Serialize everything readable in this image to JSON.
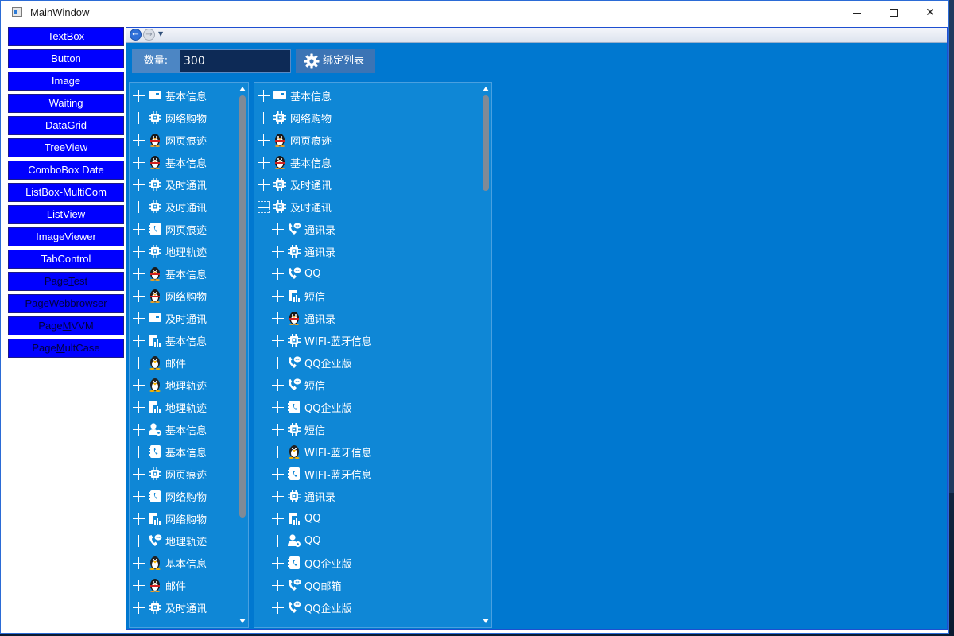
{
  "window": {
    "title": "MainWindow",
    "minimize_glyph": "",
    "close_glyph": "✕"
  },
  "sidebar": {
    "items": [
      {
        "label": "TextBox"
      },
      {
        "label": "Button"
      },
      {
        "label": "Image"
      },
      {
        "label": "Waiting"
      },
      {
        "label": "DataGrid"
      },
      {
        "label": "TreeView"
      },
      {
        "label": "ComboBox Date"
      },
      {
        "label": "ListBox-MultiCom"
      },
      {
        "label": "ListView"
      },
      {
        "label": "ImageViewer"
      },
      {
        "label": "TabControl"
      },
      {
        "label": "PageTest",
        "pre": "Page",
        "ul": "T",
        "post": "est"
      },
      {
        "label": "PageWebbrowser",
        "pre": "Page",
        "ul": "W",
        "post": "ebbrowser"
      },
      {
        "label": "PageMVVM",
        "pre": "Page",
        "ul": "M",
        "post": "VVM"
      },
      {
        "label": "PageMultCase",
        "pre": "Page",
        "ul": "M",
        "post": "ultCase"
      }
    ]
  },
  "browser_nav": {
    "back_glyph": "←",
    "forward_glyph": "→",
    "dropdown_glyph": "▼"
  },
  "toolbar": {
    "quantity_label": "数量:",
    "quantity_value": "300",
    "bind_button_label": "绑定列表"
  },
  "tree_left": {
    "rows": [
      {
        "icon": "id-card-icon",
        "label": "基本信息"
      },
      {
        "icon": "chip-icon",
        "label": "网络购物"
      },
      {
        "icon": "penguin-icon",
        "label": "网页痕迹"
      },
      {
        "icon": "penguin-icon",
        "label": "基本信息"
      },
      {
        "icon": "chip-icon",
        "label": "及时通讯"
      },
      {
        "icon": "chip-icon",
        "label": "及时通讯"
      },
      {
        "icon": "phone-book-icon",
        "label": "网页痕迹"
      },
      {
        "icon": "chip-icon",
        "label": "地理轨迹"
      },
      {
        "icon": "penguin-icon",
        "label": "基本信息"
      },
      {
        "icon": "penguin-icon",
        "label": "网络购物"
      },
      {
        "icon": "id-card-icon",
        "label": "及时通讯"
      },
      {
        "icon": "chart-doc-icon",
        "label": "基本信息"
      },
      {
        "icon": "penguin-color-icon",
        "label": "邮件"
      },
      {
        "icon": "penguin-color-icon",
        "label": "地理轨迹"
      },
      {
        "icon": "chart-doc-icon",
        "label": "地理轨迹"
      },
      {
        "icon": "user-gear-icon",
        "label": "基本信息"
      },
      {
        "icon": "phone-book-icon",
        "label": "基本信息"
      },
      {
        "icon": "chip-icon",
        "label": "网页痕迹"
      },
      {
        "icon": "phone-book-icon",
        "label": "网络购物"
      },
      {
        "icon": "chart-doc-icon",
        "label": "网络购物"
      },
      {
        "icon": "phone-chat-icon",
        "label": "地理轨迹"
      },
      {
        "icon": "penguin-color-icon",
        "label": "基本信息"
      },
      {
        "icon": "penguin-icon",
        "label": "邮件"
      },
      {
        "icon": "chip-icon",
        "label": "及时通讯"
      }
    ]
  },
  "tree_right": {
    "rows": [
      {
        "indent": 0,
        "icon": "id-card-icon",
        "label": "基本信息",
        "open": false
      },
      {
        "indent": 0,
        "icon": "chip-icon",
        "label": "网络购物",
        "open": false
      },
      {
        "indent": 0,
        "icon": "penguin-icon",
        "label": "网页痕迹",
        "open": false
      },
      {
        "indent": 0,
        "icon": "penguin-icon",
        "label": "基本信息",
        "open": false
      },
      {
        "indent": 0,
        "icon": "chip-icon",
        "label": "及时通讯",
        "open": false
      },
      {
        "indent": 0,
        "icon": "chip-icon",
        "label": "及时通讯",
        "open": true
      },
      {
        "indent": 1,
        "icon": "phone-chat-icon",
        "label": "通讯录",
        "open": false
      },
      {
        "indent": 1,
        "icon": "chip-icon",
        "label": "通讯录",
        "open": false
      },
      {
        "indent": 1,
        "icon": "phone-chat-icon",
        "label": "QQ",
        "open": false
      },
      {
        "indent": 1,
        "icon": "chart-doc-icon",
        "label": "短信",
        "open": false
      },
      {
        "indent": 1,
        "icon": "penguin-icon",
        "label": "通讯录",
        "open": false
      },
      {
        "indent": 1,
        "icon": "chip-icon",
        "label": "WIFI-蓝牙信息",
        "open": false
      },
      {
        "indent": 1,
        "icon": "phone-chat-icon",
        "label": "QQ企业版",
        "open": false
      },
      {
        "indent": 1,
        "icon": "phone-chat-icon",
        "label": "短信",
        "open": false
      },
      {
        "indent": 1,
        "icon": "phone-book-icon",
        "label": "QQ企业版",
        "open": false
      },
      {
        "indent": 1,
        "icon": "chip-icon",
        "label": "短信",
        "open": false
      },
      {
        "indent": 1,
        "icon": "penguin-color-icon",
        "label": "WIFI-蓝牙信息",
        "open": false
      },
      {
        "indent": 1,
        "icon": "phone-book-icon",
        "label": "WIFI-蓝牙信息",
        "open": false
      },
      {
        "indent": 1,
        "icon": "chip-icon",
        "label": "通讯录",
        "open": false
      },
      {
        "indent": 1,
        "icon": "chart-doc-icon",
        "label": "QQ",
        "open": false
      },
      {
        "indent": 1,
        "icon": "user-gear-icon",
        "label": "QQ",
        "open": false
      },
      {
        "indent": 1,
        "icon": "phone-book-icon",
        "label": "QQ企业版",
        "open": false
      },
      {
        "indent": 1,
        "icon": "phone-chat-icon",
        "label": "QQ邮箱",
        "open": false
      },
      {
        "indent": 1,
        "icon": "phone-chat-icon",
        "label": "QQ企业版",
        "open": false
      }
    ]
  },
  "colors": {
    "nav_button_bg": "#0000ff",
    "content_bg": "#0078d0",
    "tree_bg": "#0f87d6"
  }
}
